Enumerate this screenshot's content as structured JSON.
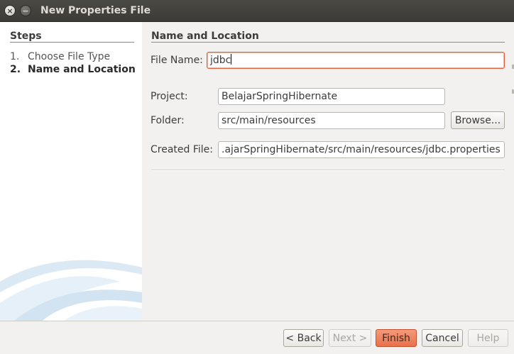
{
  "window": {
    "title": "New Properties File"
  },
  "steps": {
    "heading": "Steps",
    "items": [
      {
        "num": "1.",
        "label": "Choose File Type"
      },
      {
        "num": "2.",
        "label": "Name and Location"
      }
    ]
  },
  "panel": {
    "heading": "Name and Location",
    "file_name_label": "File Name:",
    "file_name_value": "jdbc",
    "project_label": "Project:",
    "project_value": "BelajarSpringHibernate",
    "folder_label": "Folder:",
    "folder_value": "src/main/resources",
    "browse_label": "Browse...",
    "created_label": "Created File:",
    "created_value": ".ajarSpringHibernate/src/main/resources/jdbc.properties"
  },
  "buttons": {
    "back": "< Back",
    "next": "Next >",
    "finish": "Finish",
    "cancel": "Cancel",
    "help": "Help"
  }
}
